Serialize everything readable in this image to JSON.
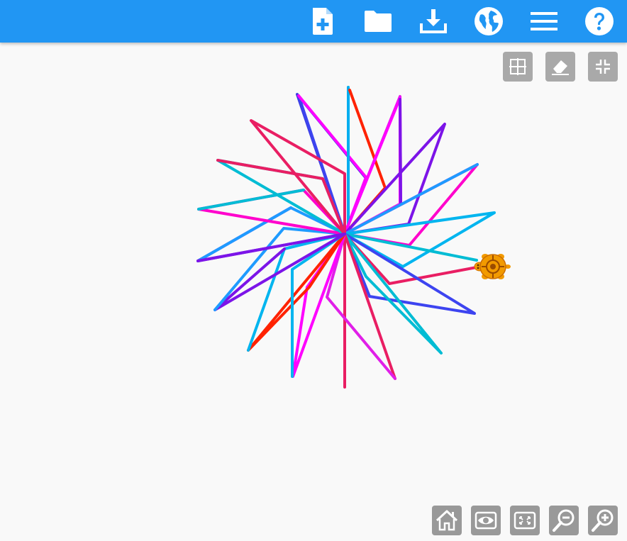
{
  "toolbar": {
    "color": "#2196f3",
    "buttons": [
      {
        "name": "new-project-icon"
      },
      {
        "name": "open-project-icon"
      },
      {
        "name": "save-project-icon"
      },
      {
        "name": "language-globe-icon"
      },
      {
        "name": "menu-icon"
      },
      {
        "name": "help-icon"
      }
    ]
  },
  "canvas_tools": [
    {
      "name": "grid-toggle-icon"
    },
    {
      "name": "clear-canvas-icon"
    },
    {
      "name": "collapse-canvas-icon"
    }
  ],
  "nav_buttons": [
    {
      "name": "home-icon"
    },
    {
      "name": "show-hide-icon"
    },
    {
      "name": "fit-to-screen-icon"
    },
    {
      "name": "zoom-out-icon"
    },
    {
      "name": "zoom-in-icon"
    }
  ],
  "drawing": {
    "colors": [
      "#e91e63",
      "#ff00ff",
      "#7c14e8",
      "#00bcd4",
      "#1e9bff",
      "#ff2200"
    ],
    "turtle_color": "#f29a00"
  }
}
